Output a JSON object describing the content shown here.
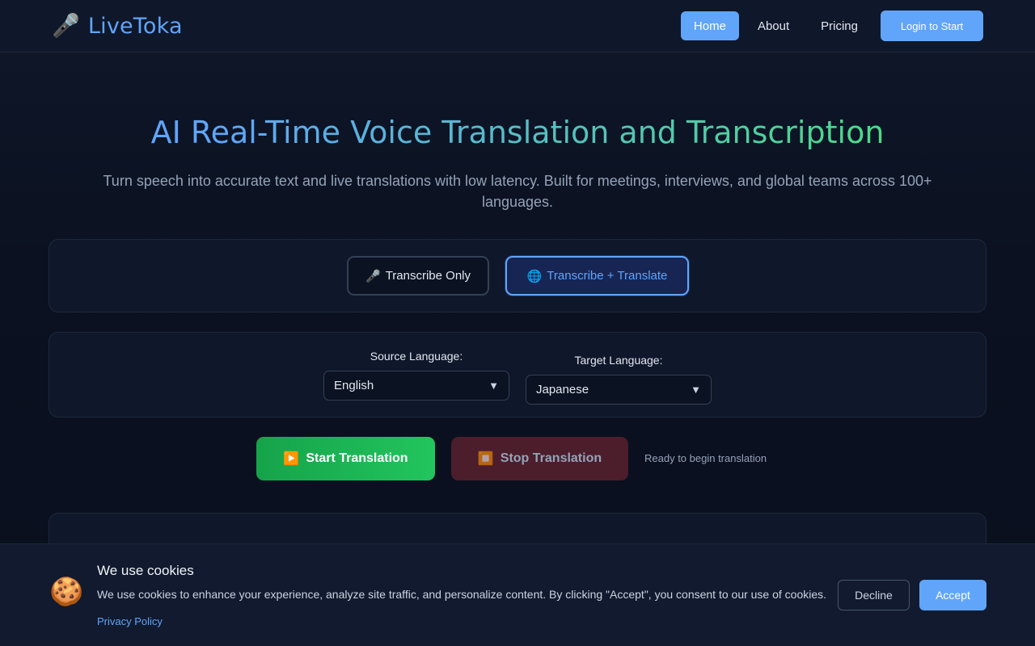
{
  "header": {
    "logo_icon": "🎤",
    "logo_text": "LiveToka",
    "nav": [
      {
        "label": "Home",
        "active": true
      },
      {
        "label": "About",
        "active": false
      },
      {
        "label": "Pricing",
        "active": false
      }
    ],
    "login_label": "Login to Start"
  },
  "hero": {
    "title": "AI Real-Time Voice Translation and Transcription",
    "subtitle": "Turn speech into accurate text and live translations with low latency. Built for meetings, interviews, and global teams across 100+ languages."
  },
  "modes": {
    "transcribe_icon": "🎤",
    "transcribe_label": "Transcribe Only",
    "translate_icon": "🌐",
    "translate_label": "Transcribe + Translate",
    "selected": "Transcribe + Translate"
  },
  "languages": {
    "source_label": "Source Language:",
    "source_value": "English",
    "target_label": "Target Language:",
    "target_value": "Japanese",
    "arrow_icon": "▼"
  },
  "actions": {
    "start_icon": "▶️",
    "start_label": "Start Translation",
    "stop_icon": "⏹️",
    "stop_label": "Stop Translation",
    "status": "Ready to begin translation"
  },
  "cookie": {
    "icon": "🍪",
    "title": "We use cookies",
    "text": "We use cookies to enhance your experience, analyze site traffic, and personalize content. By clicking \"Accept\", you consent to our use of cookies.",
    "privacy_label": "Privacy Policy",
    "decline_label": "Decline",
    "accept_label": "Accept"
  },
  "colors": {
    "accent": "#60a5fa",
    "start_green": "#22c55e",
    "stop_red": "#4c1d2b",
    "background": "#0b1120"
  }
}
